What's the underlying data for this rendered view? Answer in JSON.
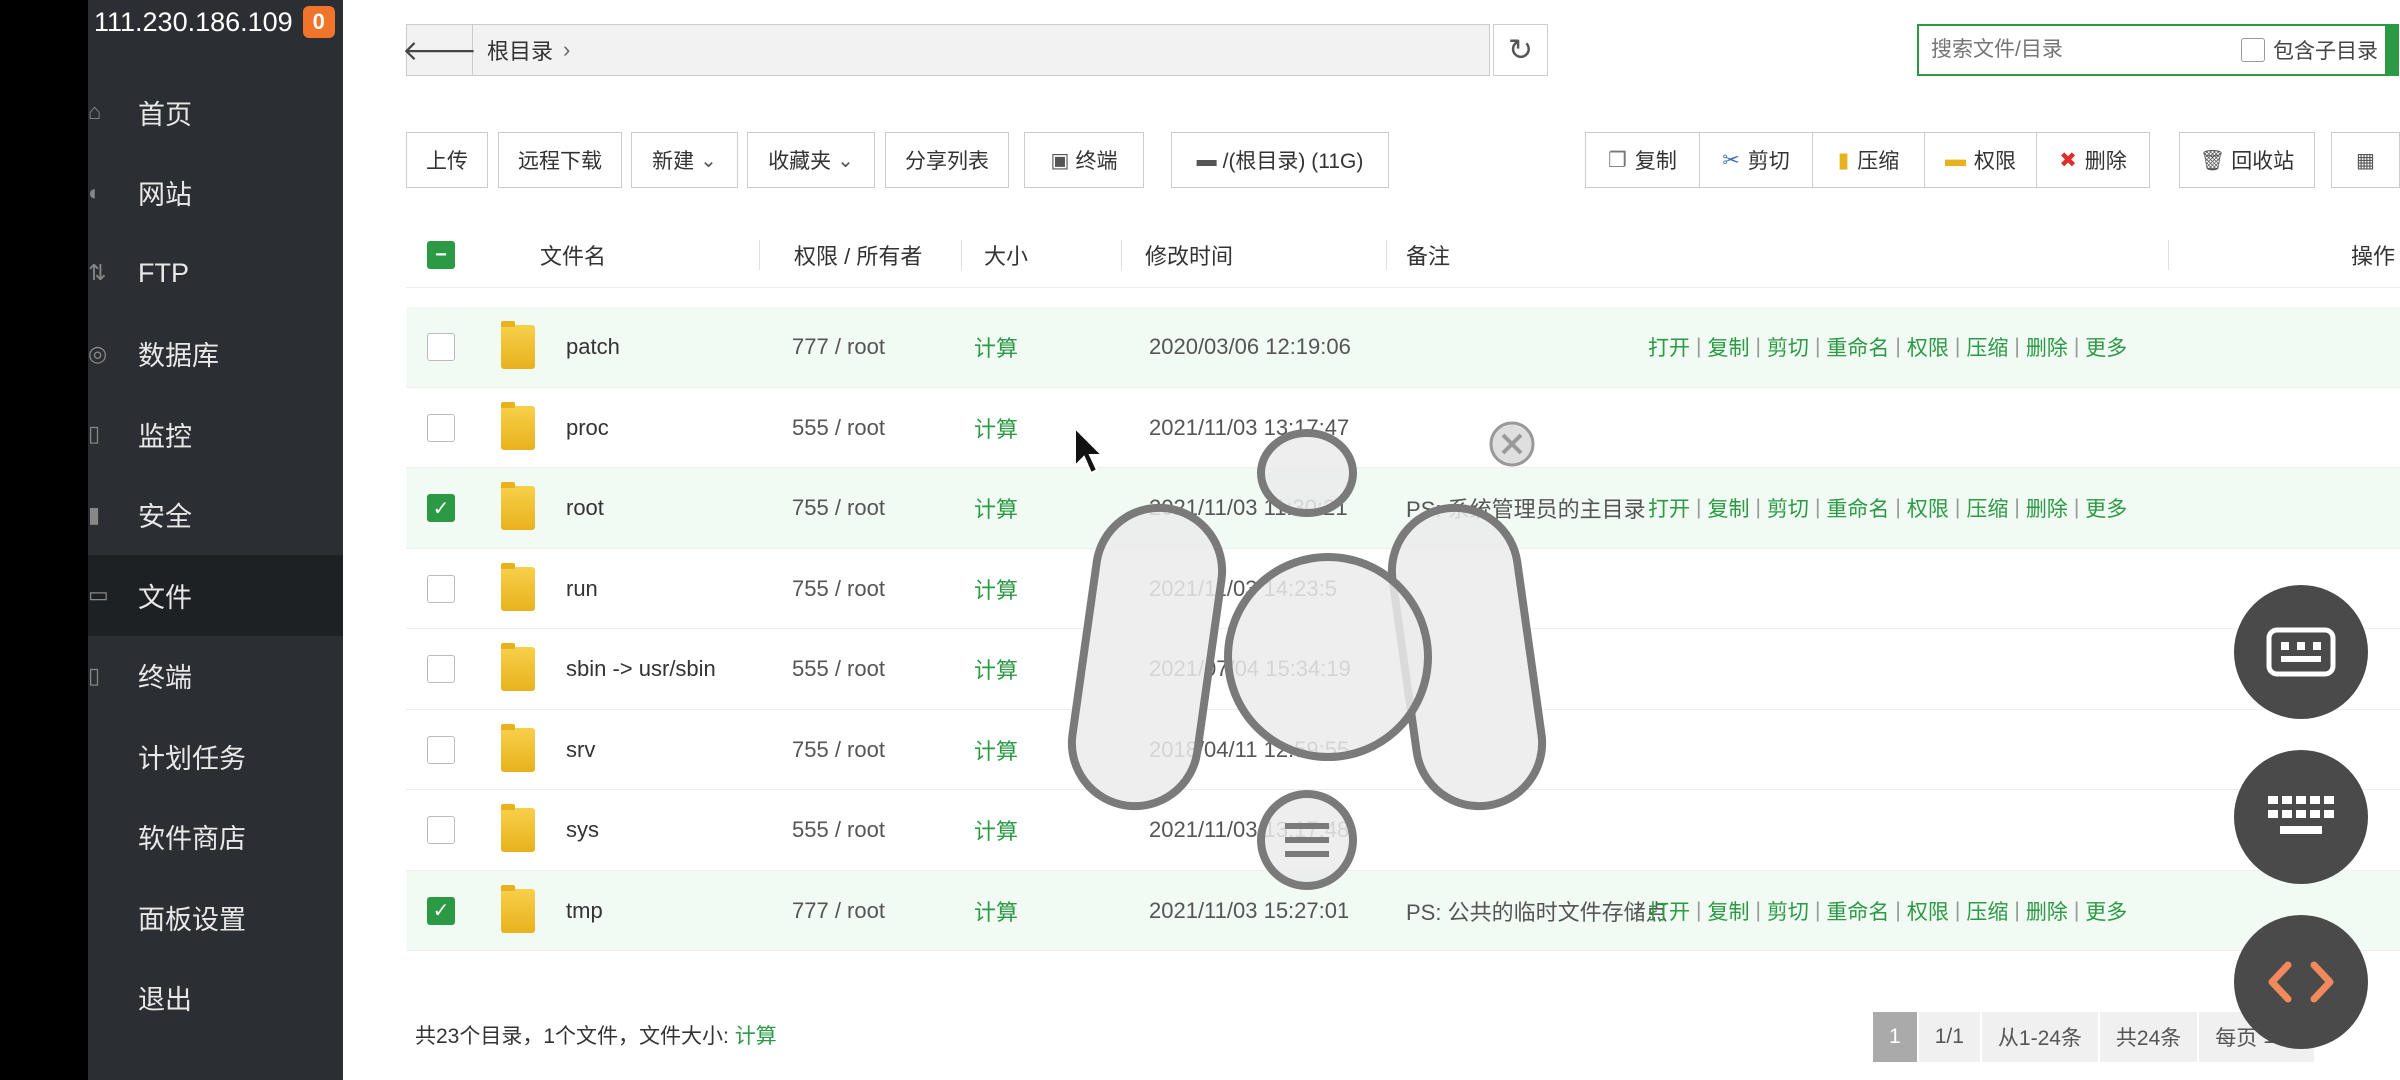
{
  "server": {
    "ip": "111.230.186.109",
    "badge_count": "0"
  },
  "sidebar": {
    "items": [
      {
        "label": "首页",
        "icon": "home-icon"
      },
      {
        "label": "网站",
        "icon": "globe-icon"
      },
      {
        "label": "FTP",
        "icon": "ftp-icon"
      },
      {
        "label": "数据库",
        "icon": "database-icon"
      },
      {
        "label": "监控",
        "icon": "monitor-icon"
      },
      {
        "label": "安全",
        "icon": "shield-icon"
      },
      {
        "label": "文件",
        "icon": "folder-icon",
        "active": true
      },
      {
        "label": "终端",
        "icon": "terminal-icon"
      },
      {
        "label": "计划任务",
        "icon": "clock-icon"
      },
      {
        "label": "软件商店",
        "icon": "store-icon"
      },
      {
        "label": "面板设置",
        "icon": "settings-icon"
      },
      {
        "label": "退出",
        "icon": "logout-icon"
      }
    ]
  },
  "path": {
    "root_label": "根目录",
    "separator": "›"
  },
  "search": {
    "placeholder": "搜索文件/目录",
    "include_sub_label": "包含子目录"
  },
  "toolbar": {
    "upload": "上传",
    "remote_download": "远程下载",
    "new": "新建",
    "favorites": "收藏夹",
    "share_list": "分享列表",
    "terminal": "终端",
    "disk": "/(根目录) (11G)",
    "copy": "复制",
    "cut": "剪切",
    "compress": "压缩",
    "permission": "权限",
    "delete": "删除",
    "recycle": "回收站"
  },
  "table": {
    "headers": {
      "name": "文件名",
      "perm": "权限 / 所有者",
      "size": "大小",
      "mtime": "修改时间",
      "note": "备注",
      "ops": "操作"
    },
    "rows": [
      {
        "name": "patch",
        "perm": "777 / root",
        "size": "计算",
        "mtime": "2020/03/06 12:19:06",
        "note": "",
        "checked": false,
        "hl": true,
        "show_ops": true
      },
      {
        "name": "proc",
        "perm": "555 / root",
        "size": "计算",
        "mtime": "2021/11/03 13:17:47",
        "note": "",
        "checked": false,
        "hl": false,
        "show_ops": false
      },
      {
        "name": "root",
        "perm": "755 / root",
        "size": "计算",
        "mtime": "2021/11/03 11:30:21",
        "note": "PS: 系统管理员的主目录",
        "checked": true,
        "hl": true,
        "show_ops": true
      },
      {
        "name": "run",
        "perm": "755 / root",
        "size": "计算",
        "mtime": "2021/11/03 14:23:5",
        "note": "",
        "checked": false,
        "hl": false,
        "show_ops": false
      },
      {
        "name": "sbin -> usr/sbin",
        "perm": "555 / root",
        "size": "计算",
        "mtime": "2021/07/04 15:34:19",
        "note": "",
        "checked": false,
        "hl": false,
        "show_ops": false
      },
      {
        "name": "srv",
        "perm": "755 / root",
        "size": "计算",
        "mtime": "2018/04/11 12:59:55",
        "note": "",
        "checked": false,
        "hl": false,
        "show_ops": false
      },
      {
        "name": "sys",
        "perm": "555 / root",
        "size": "计算",
        "mtime": "2021/11/03 13:17:48",
        "note": "",
        "checked": false,
        "hl": false,
        "show_ops": false
      },
      {
        "name": "tmp",
        "perm": "777 / root",
        "size": "计算",
        "mtime": "2021/11/03 15:27:01",
        "note": "PS: 公共的临时文件存储点",
        "checked": true,
        "hl": true,
        "show_ops": true
      }
    ],
    "ops": [
      "打开",
      "复制",
      "剪切",
      "重命名",
      "权限",
      "压缩",
      "删除",
      "更多"
    ]
  },
  "footer": {
    "summary": "共23个目录，1个文件，文件大小:",
    "calc": "计算"
  },
  "pager": {
    "current": "1",
    "pages": "1/1",
    "range": "从1-24条",
    "total": "共24条",
    "per_page_label": "每页",
    "per_page": "100"
  },
  "colors": {
    "accent": "#2c9a45",
    "sidebar_bg": "#2b2f33",
    "badge": "#f0752b"
  }
}
